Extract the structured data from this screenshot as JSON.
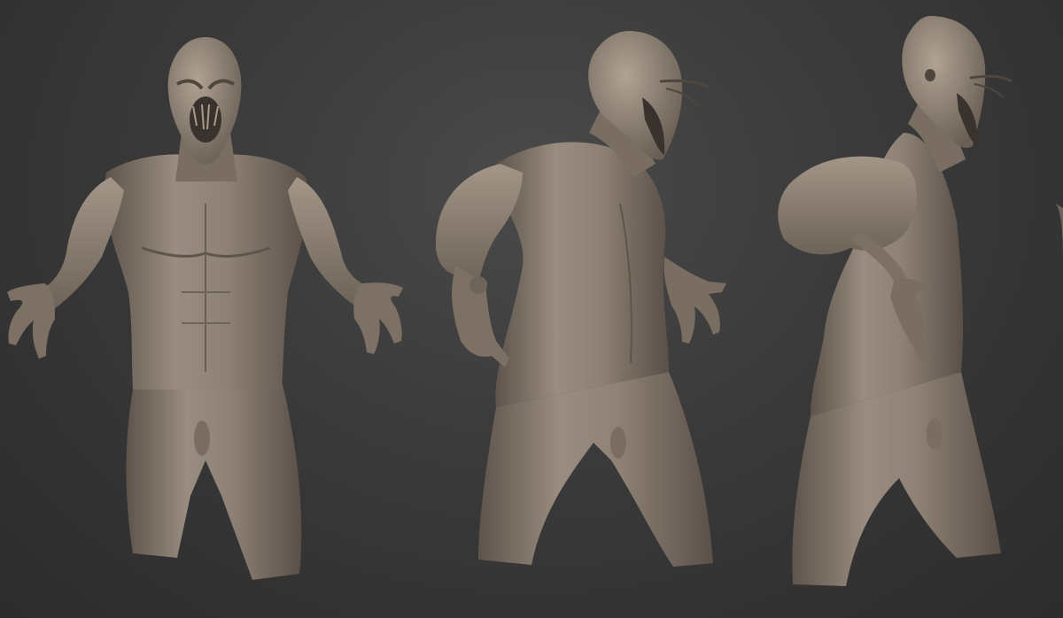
{
  "scene": {
    "background_color": "#3a3a3a",
    "material_color": "#8e8175",
    "material_shadow": "#5e544b",
    "material_highlight": "#b3a698",
    "figures": [
      {
        "view": "front"
      },
      {
        "view": "three-quarter"
      },
      {
        "view": "side"
      }
    ]
  }
}
